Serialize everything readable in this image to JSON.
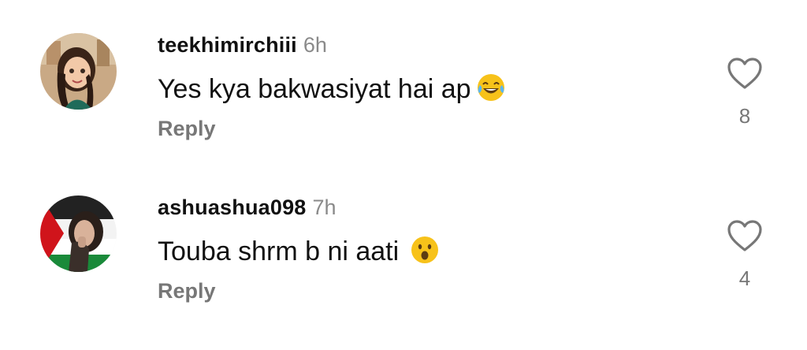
{
  "comments": [
    {
      "username": "teekhimirchiii",
      "time": "6h",
      "text": "Yes kya bakwasiyat hai ap",
      "emoji": "laughing-tears-emoji",
      "reply_label": "Reply",
      "likes": "8"
    },
    {
      "username": "ashuashua098",
      "time": "7h",
      "text": "Touba shrm b ni aati",
      "emoji": "surprised-face-emoji",
      "reply_label": "Reply",
      "likes": "4"
    }
  ],
  "colors": {
    "text": "#111111",
    "muted": "#777777",
    "time": "#8a8a8a",
    "emoji_yellow": "#f7c21a"
  }
}
